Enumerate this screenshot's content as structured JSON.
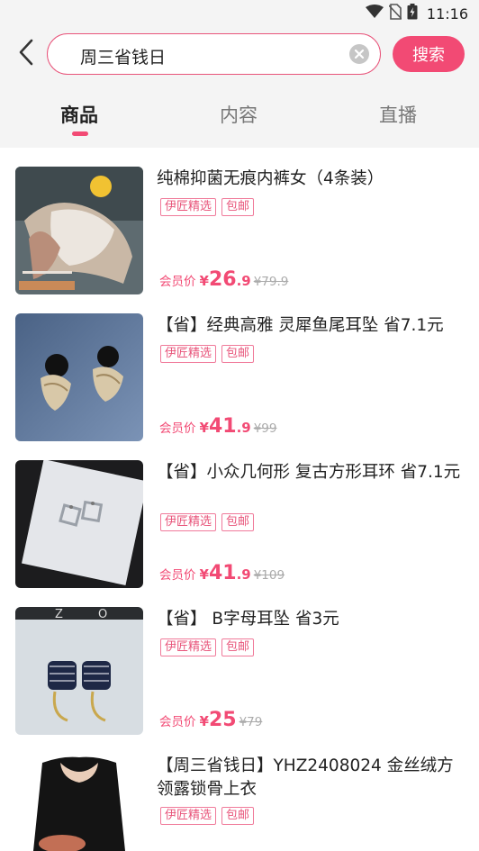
{
  "status_bar": {
    "time": "11:16",
    "icons": [
      "wifi-icon",
      "no-sim-icon",
      "battery-icon"
    ]
  },
  "header": {
    "back_icon": "chevron-left-icon",
    "search": {
      "value": "周三省钱日",
      "clear_icon": "clear-circle-icon"
    },
    "search_button": "搜索",
    "tabs": [
      {
        "label": "商品",
        "active": true
      },
      {
        "label": "内容",
        "active": false
      },
      {
        "label": "直播",
        "active": false
      }
    ]
  },
  "colors": {
    "accent": "#f24a74",
    "tag_border": "#f07a9a"
  },
  "products": [
    {
      "title": "纯棉抑菌无痕内裤女（4条装）",
      "tags": [
        "伊匠精选",
        "包邮"
      ],
      "member_label": "会员价",
      "currency": "¥",
      "price_int": "26",
      "price_dec": ".9",
      "original_price": "¥79.9"
    },
    {
      "title": "【省】经典高雅 灵犀鱼尾耳坠 省7.1元",
      "tags": [
        "伊匠精选",
        "包邮"
      ],
      "member_label": "会员价",
      "currency": "¥",
      "price_int": "41",
      "price_dec": ".9",
      "original_price": "¥99"
    },
    {
      "title": "【省】小众几何形 复古方形耳环 省7.1元",
      "tags": [
        "伊匠精选",
        "包邮"
      ],
      "member_label": "会员价",
      "currency": "¥",
      "price_int": "41",
      "price_dec": ".9",
      "original_price": "¥109"
    },
    {
      "title": "【省】 B字母耳坠 省3元",
      "tags": [
        "伊匠精选",
        "包邮"
      ],
      "member_label": "会员价",
      "currency": "¥",
      "price_int": "25",
      "price_dec": "",
      "original_price": "¥79"
    },
    {
      "title": "【周三省钱日】YHZ2408024 金丝绒方领露锁骨上衣",
      "tags": [
        "伊匠精选",
        "包邮"
      ]
    }
  ]
}
